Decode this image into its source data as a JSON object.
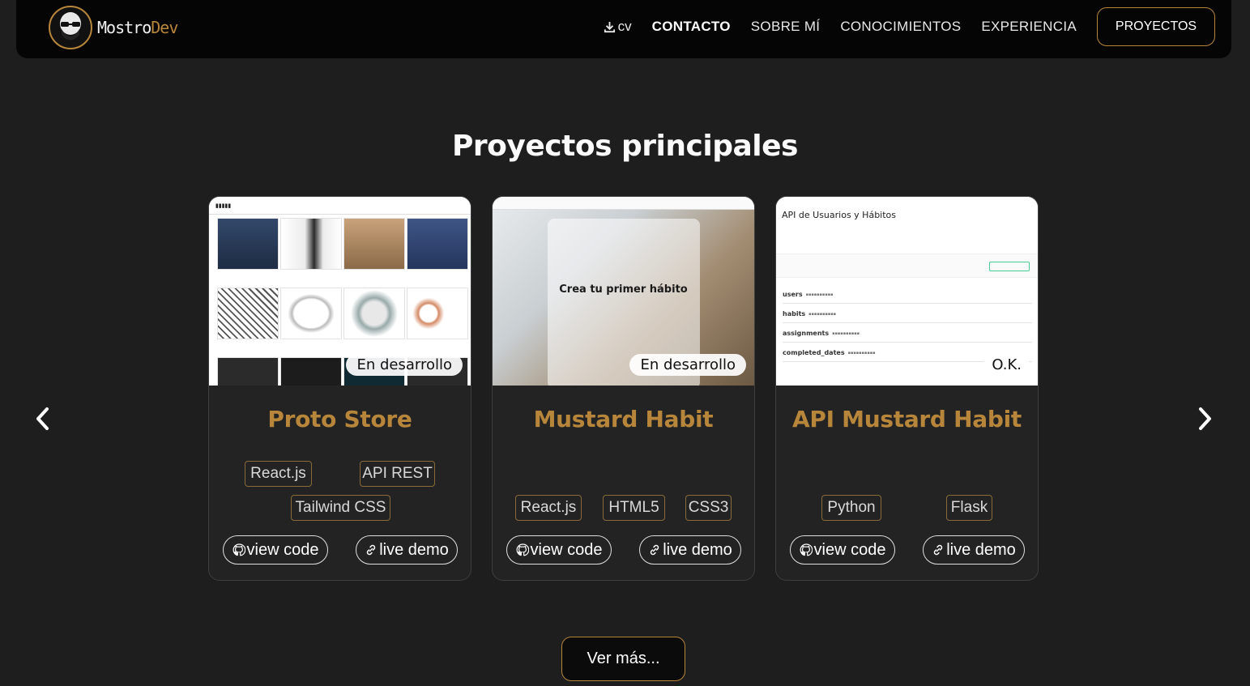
{
  "nav": {
    "brand": {
      "name_part1": "Mostro",
      "name_part2": "Dev"
    },
    "cv_label": "cv",
    "links": [
      "CONTACTO",
      "SOBRE MÍ",
      "CONOCIMIENTOS",
      "EXPERIENCIA"
    ],
    "button_label": "PROYECTOS"
  },
  "section": {
    "title": "Proyectos principales"
  },
  "projects": [
    {
      "title": "Proto Store",
      "status": "En desarrollo",
      "tags": [
        "React.js",
        "API REST",
        "Tailwind CSS"
      ],
      "view_code": "view code",
      "live_demo": "live demo"
    },
    {
      "title": "Mustard Habit",
      "status": "En desarrollo",
      "overlay_text": "Crea tu primer hábito",
      "tags": [
        "React.js",
        "HTML5",
        "CSS3"
      ],
      "view_code": "view code",
      "live_demo": "live demo"
    },
    {
      "title": "API Mustard Habit",
      "status": "O.K.",
      "doc_title": "API de Usuarios y Hábitos",
      "endpoints": [
        "users",
        "habits",
        "assignments",
        "completed_dates"
      ],
      "tags": [
        "Python",
        "Flask"
      ],
      "view_code": "view code",
      "live_demo": "live demo"
    }
  ],
  "footer": {
    "more_label": "Ver más..."
  },
  "colors": {
    "accent": "#b8863b",
    "background": "#1e1e1e",
    "card": "#232323",
    "navbar": "#050505"
  },
  "icons": [
    "download-icon",
    "chevron-left-icon",
    "chevron-right-icon",
    "github-icon",
    "link-icon"
  ]
}
